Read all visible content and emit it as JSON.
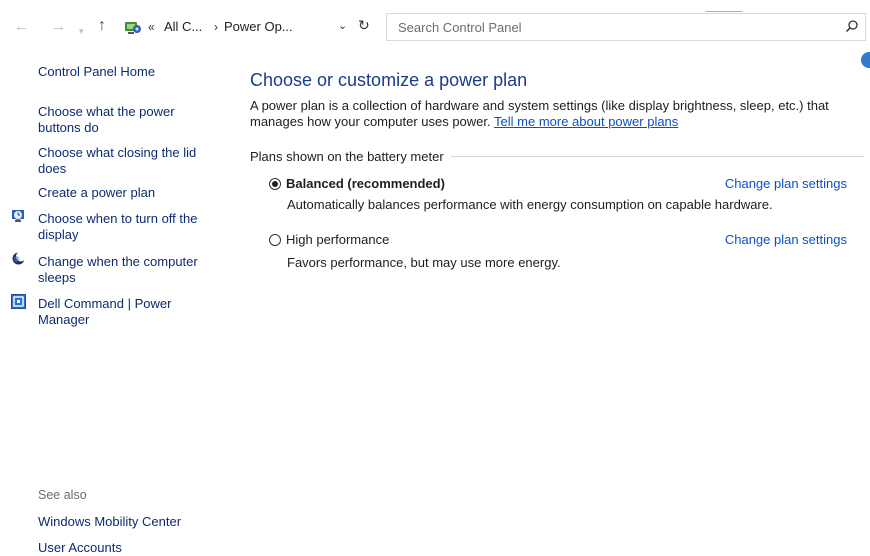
{
  "address_bar": {
    "nav": {
      "back_glyph": "←",
      "forward_glyph": "→",
      "recent_glyph": "▾",
      "up_glyph": "↑"
    },
    "breadcrumb": [
      {
        "prefix": "«",
        "label": "All C..."
      },
      {
        "prefix": "›",
        "label": "Power Op..."
      }
    ],
    "dropdown_glyph": "⌄",
    "refresh_glyph": "↻",
    "search_placeholder": "Search Control Panel",
    "icons": [
      "back-arrow-icon",
      "forward-arrow-icon",
      "up-arrow-icon",
      "control-panel-icon",
      "refresh-icon",
      "search-icon"
    ]
  },
  "sidebar": {
    "home": "Control Panel Home",
    "links": [
      {
        "line1": "Choose what the power",
        "line2": "buttons do",
        "icon": ""
      },
      {
        "line1": "Choose what closing the lid",
        "line2": "does",
        "icon": ""
      },
      {
        "line1": "Create a power plan",
        "line2": "",
        "icon": ""
      },
      {
        "line1": "Choose when to turn off the",
        "line2": "display",
        "icon": "display-clock-icon"
      },
      {
        "line1": "Change when the computer",
        "line2": "sleeps",
        "icon": "moon-sleep-icon"
      },
      {
        "line1": "Dell Command | Power",
        "line2": "Manager",
        "icon": "dell-command-icon"
      }
    ],
    "see_also": {
      "label": "See also",
      "links": [
        "Windows Mobility Center",
        "User Accounts"
      ]
    }
  },
  "main": {
    "title": "Choose or customize a power plan",
    "description": "A power plan is a collection of hardware and system settings (like display brightness, sleep, etc.) that manages how your computer uses power.",
    "learn_more": "Tell me more about power plans",
    "group_label": "Plans shown on the battery meter",
    "plans": [
      {
        "name": "Balanced (recommended)",
        "selected": true,
        "description": "Automatically balances performance with energy consumption on capable hardware.",
        "change_link": "Change plan settings"
      },
      {
        "name": "High performance",
        "selected": false,
        "description": "Favors performance, but may use more energy.",
        "change_link": "Change plan settings"
      }
    ]
  },
  "colors": {
    "link": "#0c2b72",
    "title": "#1a3c8b",
    "hyperlink": "#0c50c8",
    "muted": "#6b6b6b",
    "help_badge": "#3277d2"
  }
}
